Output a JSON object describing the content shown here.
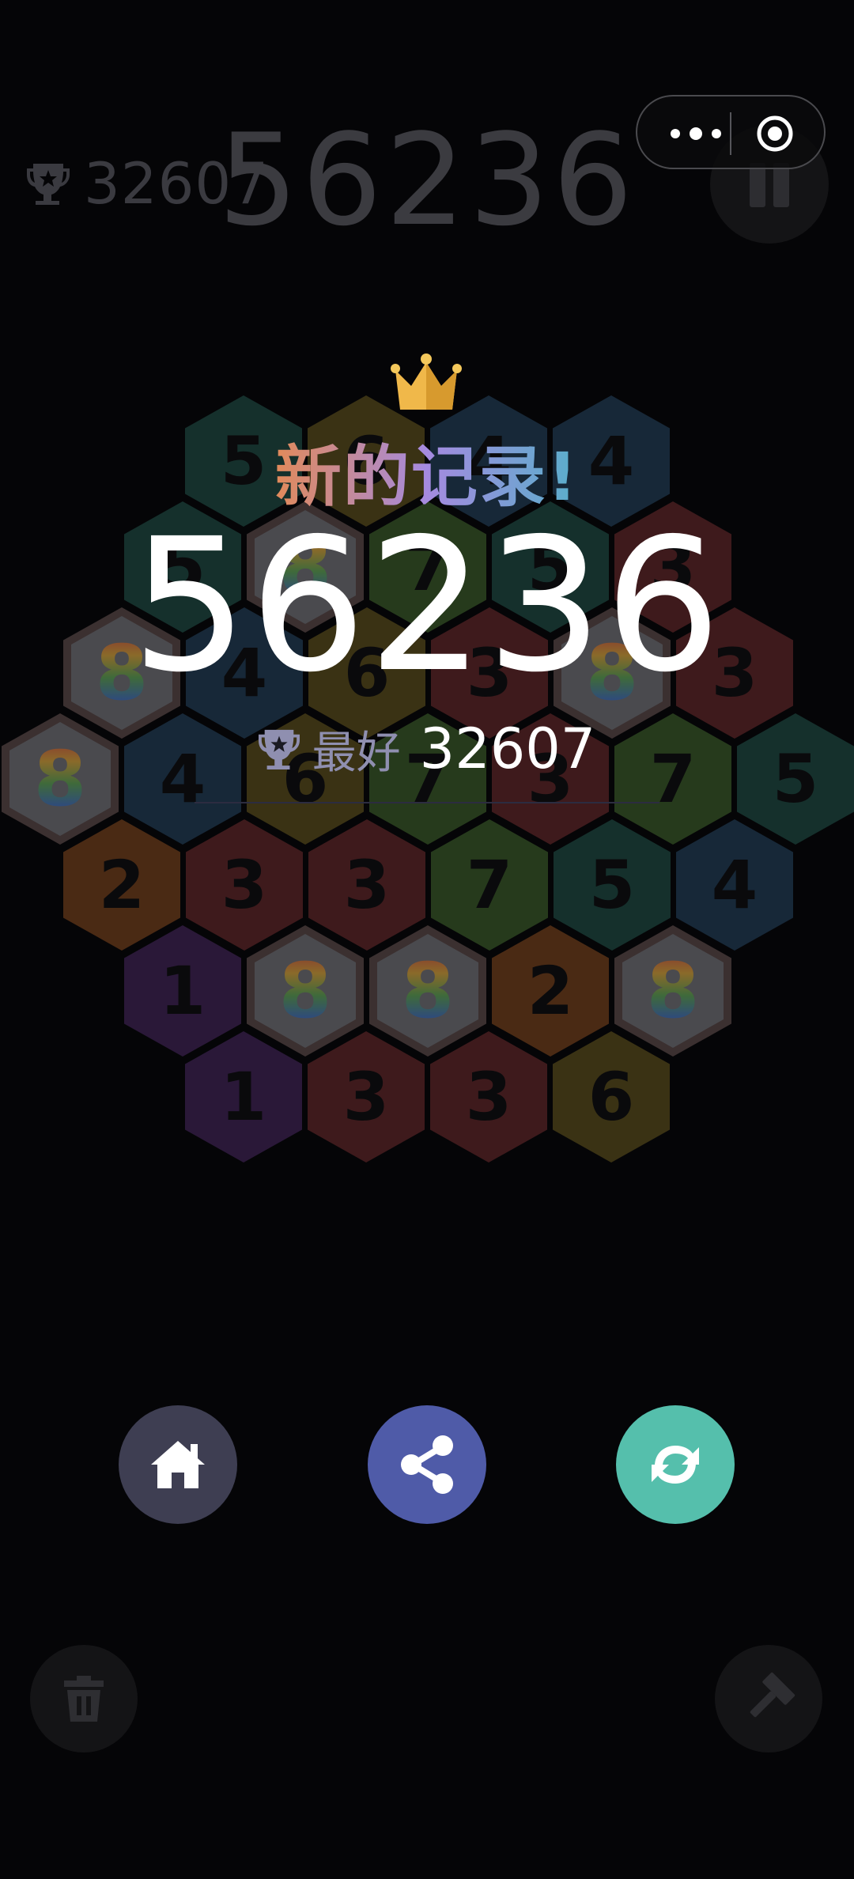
{
  "hud": {
    "best_score": "32607",
    "score": "56236"
  },
  "board": {
    "rows": [
      [
        "5",
        "6",
        "4",
        "4"
      ],
      [
        "5",
        "8",
        "7",
        "5",
        "3"
      ],
      [
        "8",
        "4",
        "6",
        "3",
        "8",
        "3"
      ],
      [
        "8",
        "4",
        "6",
        "7",
        "3",
        "7",
        "5"
      ],
      [
        "2",
        "3",
        "3",
        "7",
        "5",
        "4"
      ],
      [
        "1",
        "8",
        "8",
        "2",
        "8"
      ],
      [
        "1",
        "3",
        "3",
        "6"
      ]
    ],
    "tile_colors": {
      "1": "#2a1838",
      "2": "#4a2a14",
      "3": "#3e1a1c",
      "4": "#172838",
      "5": "#15302c",
      "6": "#3a3214",
      "7": "#263a1c",
      "8": "rainbow"
    }
  },
  "overlay": {
    "title": "新的记录!",
    "score": "56236",
    "best_label": "最好",
    "best_value": "32607"
  },
  "buttons": {
    "home": "home-icon",
    "share": "share-icon",
    "restart": "restart-icon"
  },
  "tools": {
    "trash": "trash-icon",
    "hammer": "hammer-icon"
  },
  "colors": {
    "home_button": "#3e3e52",
    "share_button": "#4f5ba8",
    "restart_button": "#55bfac"
  }
}
